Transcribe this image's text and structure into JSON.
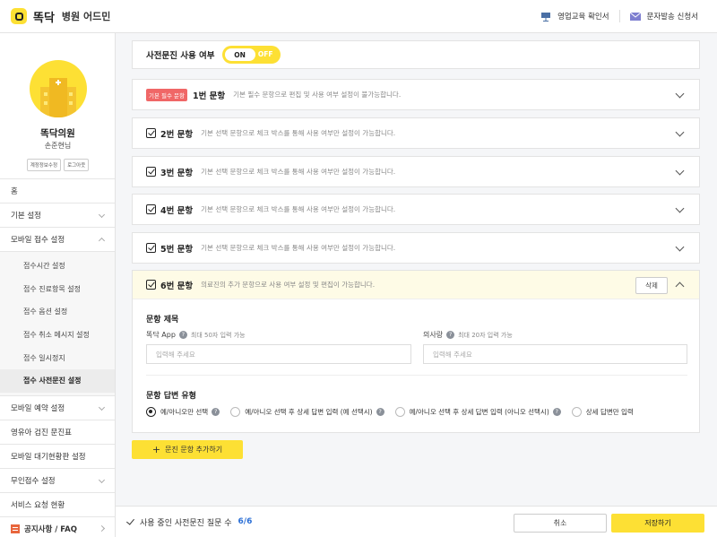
{
  "header": {
    "brand": "똑닥",
    "subtitle": "병원 어드민",
    "links": [
      {
        "label": "영업교육 확인서",
        "icon": "presentation-board-icon"
      },
      {
        "label": "문자발송 신청서",
        "icon": "envelope-icon"
      }
    ]
  },
  "sidebar": {
    "hospital_name": "똑닥의원",
    "user_name": "손준현님",
    "account_buttons": [
      "계정정보수정",
      "로그아웃"
    ],
    "menu": [
      {
        "label": "홈"
      },
      {
        "label": "기본 설정"
      },
      {
        "label": "모바일 접수 설정"
      },
      {
        "label": "모바일 예약 설정"
      },
      {
        "label": "영유아 검진 문진표"
      },
      {
        "label": "모바일 대기현황판 설정"
      },
      {
        "label": "무인접수 설정"
      },
      {
        "label": "서비스 요청 현황"
      },
      {
        "label": "공지사항 / FAQ"
      }
    ],
    "submenu": [
      "접수시간 설정",
      "접수 진료항목 설정",
      "접수 옵션 설정",
      "접수 취소 메시지 설정",
      "접수 일시정지",
      "접수 사전문진 설정"
    ]
  },
  "toggle": {
    "label": "사전문진 사용 여부",
    "on": "ON",
    "off": "OFF"
  },
  "questions": [
    {
      "badge": "기본 필수 문항",
      "title": "1번 문항",
      "desc": "기본 필수 문항으로 편집 및 사용 여부 설정이 불가능합니다."
    },
    {
      "title": "2번 문항",
      "desc": "기본 선택 문항으로 체크 박스를 통해 사용 여부만 설정이 가능합니다."
    },
    {
      "title": "3번 문항",
      "desc": "기본 선택 문항으로 체크 박스를 통해 사용 여부만 설정이 가능합니다."
    },
    {
      "title": "4번 문항",
      "desc": "기본 선택 문항으로 체크 박스를 통해 사용 여부만 설정이 가능합니다."
    },
    {
      "title": "5번 문항",
      "desc": "기본 선택 문항으로 체크 박스를 통해 사용 여부만 설정이 가능합니다."
    }
  ],
  "q6": {
    "title": "6번 문항",
    "desc": "의료진의 추가 문항으로 사용 여부 설정 및 편집이 가능합니다.",
    "delete": "삭제",
    "section_title": "문항 제목",
    "app_label": "똑닥 App",
    "app_hint": "최대 50자 입력 가능",
    "app_placeholder": "입력해 주세요",
    "doctor_label": "의사랑",
    "doctor_hint": "최대 20자 입력 가능",
    "doctor_placeholder": "입력해 주세요",
    "answer_type_title": "문항 답변 유형",
    "options": [
      "예/아니오만 선택",
      "예/아니오 선택 후 상세 답변 입력 (예 선택시)",
      "예/아니오 선택 후 상세 답변 입력 (아니오 선택시)",
      "상세 답변만 입력"
    ],
    "selected_option": 0
  },
  "add_button": "문진 문항 추가하기",
  "footer": {
    "text": "사용 중인 사전문진 질문 수",
    "count": "6/6",
    "cancel": "취소",
    "save": "저장하기"
  },
  "colors": {
    "accent": "#fde034",
    "badge": "#f06767",
    "count": "#2b6fd6"
  }
}
